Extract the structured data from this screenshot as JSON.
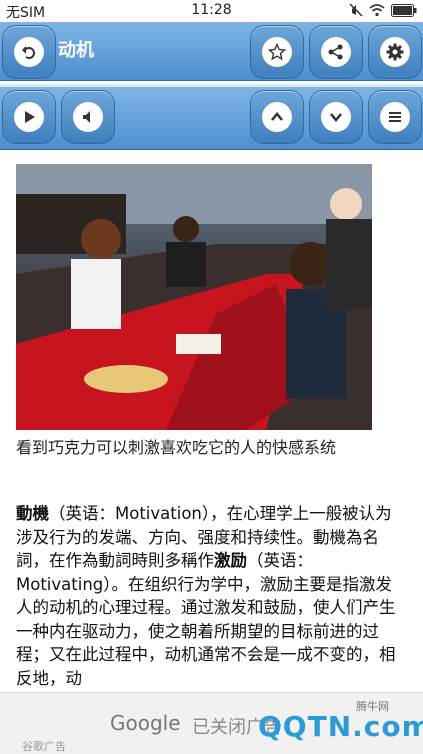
{
  "status": {
    "carrier": "无SIM",
    "time": "11:28"
  },
  "toolbar": {
    "title": "动机"
  },
  "caption": "看到巧克力可以刺激喜欢吃它的人的快感系统",
  "article": {
    "term": "動機",
    "p1": "（英语：Motivation），在心理学上一般被认为涉及行为的发端、方向、强度和持续性。動機為名詞，在作為動詞時則多稱作",
    "term2": "激励",
    "p2": "（英语：Motivating）。在组织行为学中，激励主要是指激发人的动机的心理过程。通过激发和鼓励，使人们产生一种内在驱动力，使之朝着所期望的目标前进的过程；又在此过程中，动机通常不会是一成不变的，相反地，动"
  },
  "ad": {
    "brand": "Google",
    "shown": "已关闭广告",
    "small": "谷歌广告"
  },
  "watermark": {
    "site": "腾牛网",
    "main": "QQTN.com"
  },
  "colors": {
    "toolbar": "#5d9ad4",
    "accent": "#2b9bd8"
  }
}
